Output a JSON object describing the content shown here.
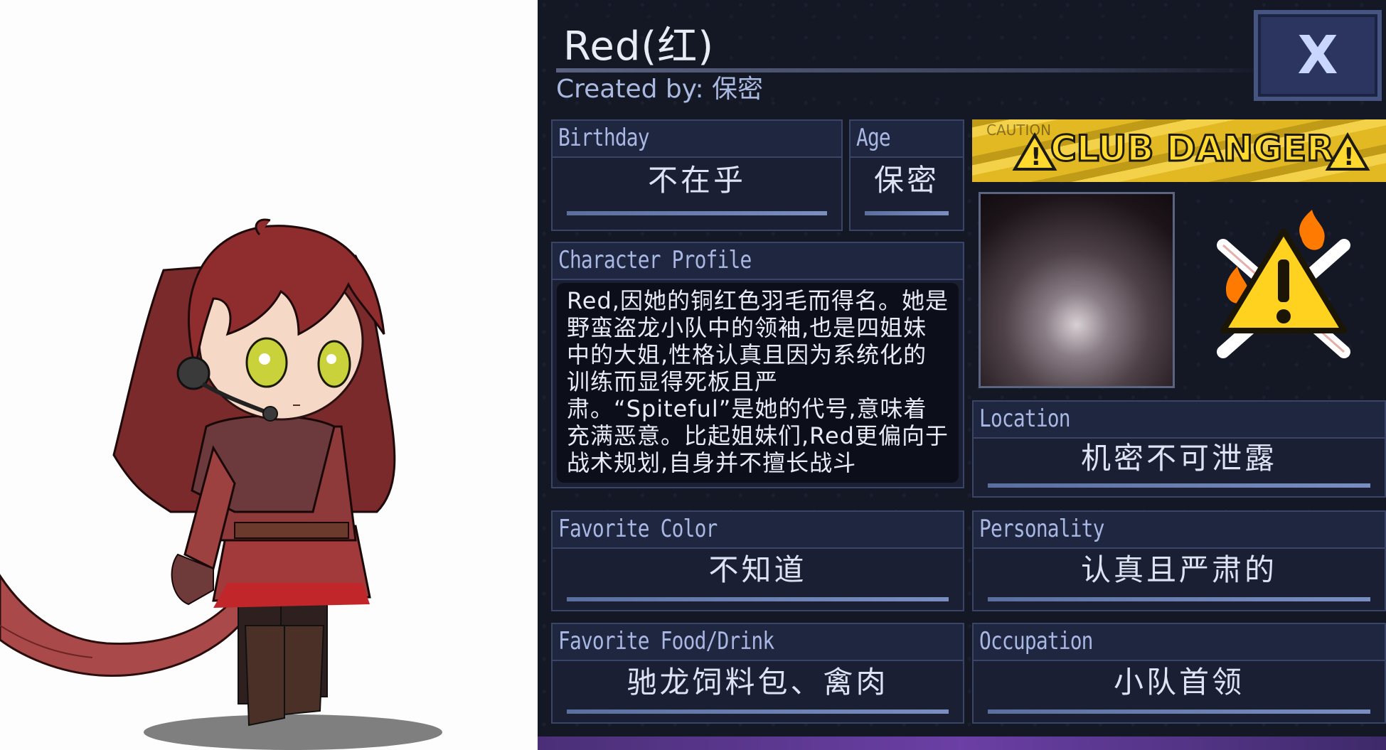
{
  "profile": {
    "name": "Red(红)",
    "created_by": "Created by: 保密",
    "close_label": "X"
  },
  "fields": {
    "birthday": {
      "label": "Birthday",
      "value": "不在乎"
    },
    "age": {
      "label": "Age",
      "value": "保密"
    },
    "character_profile": {
      "label": "Character Profile",
      "text": "Red,因她的铜红色羽毛而得名。她是野蛮盗龙小队中的领袖,也是四姐妹中的大姐,性格认真且因为系统化的训练而显得死板且严肃。“Spiteful”是她的代号,意味着充满恶意。比起姐妹们,Red更偏向于战术规划,自身并不擅长战斗"
    },
    "location": {
      "label": "Location",
      "value": "机密不可泄露"
    },
    "favorite_color": {
      "label": "Favorite Color",
      "value": "不知道"
    },
    "personality": {
      "label": "Personality",
      "value": "认真且严肃的"
    },
    "favorite_food": {
      "label": "Favorite Food/Drink",
      "value": "驰龙饲料包、禽肉"
    },
    "occupation": {
      "label": "Occupation",
      "value": "小队首领"
    }
  },
  "club": {
    "banner_text": "CLUB DANGER",
    "banner_caution_text": "CAUTION",
    "icon": "danger-warning-icon"
  },
  "colors": {
    "panel_bg": "#141825",
    "field_label": "#a9b7e3",
    "field_value": "#dde3f2",
    "accent_line": "#6b80b0",
    "banner_yellow": "#e2b923"
  }
}
